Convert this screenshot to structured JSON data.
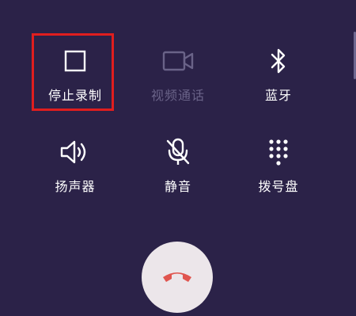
{
  "controls": {
    "record": {
      "label": "停止录制",
      "icon": "stop-square-icon",
      "active": true
    },
    "video": {
      "label": "视频通话",
      "icon": "video-camera-icon",
      "enabled": false
    },
    "bluetooth": {
      "label": "蓝牙",
      "icon": "bluetooth-icon"
    },
    "speaker": {
      "label": "扬声器",
      "icon": "speaker-icon"
    },
    "mute": {
      "label": "静音",
      "icon": "mic-muted-icon"
    },
    "dialpad": {
      "label": "拨号盘",
      "icon": "dialpad-icon"
    }
  },
  "hangup": {
    "icon": "end-call-icon",
    "color": "#e0554f"
  },
  "colors": {
    "background": "#2b2248",
    "highlight": "#e01e1e",
    "disabled": "#6a6388"
  }
}
